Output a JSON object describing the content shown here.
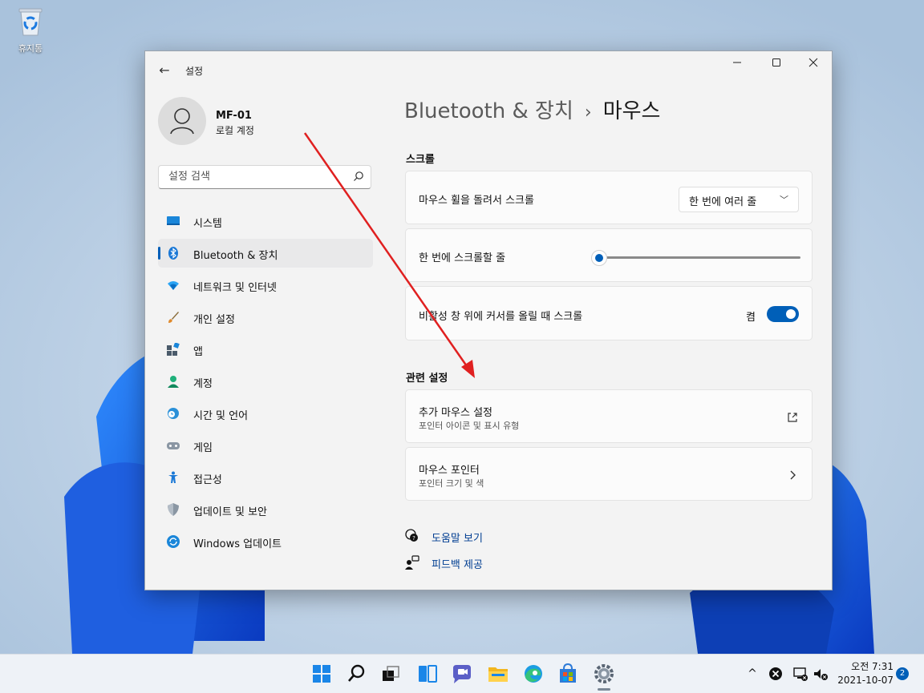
{
  "desktop": {
    "recycle_bin_label": "휴지통"
  },
  "window": {
    "app_title": "설정",
    "controls": {
      "minimize": "—",
      "maximize": "☐",
      "close": "✕"
    }
  },
  "profile": {
    "name": "MF-01",
    "account_type": "로컬 계정"
  },
  "search": {
    "placeholder": "설정 검색"
  },
  "sidebar": {
    "items": [
      {
        "label": "시스템",
        "icon": "system-icon"
      },
      {
        "label": "Bluetooth & 장치",
        "icon": "bluetooth-icon",
        "selected": true
      },
      {
        "label": "네트워크 및 인터넷",
        "icon": "network-icon"
      },
      {
        "label": "개인 설정",
        "icon": "personalization-brush-icon"
      },
      {
        "label": "앱",
        "icon": "apps-icon"
      },
      {
        "label": "계정",
        "icon": "accounts-icon"
      },
      {
        "label": "시간 및 언어",
        "icon": "time-language-icon"
      },
      {
        "label": "게임",
        "icon": "gaming-icon"
      },
      {
        "label": "접근성",
        "icon": "accessibility-icon"
      },
      {
        "label": "업데이트 및 보안",
        "icon": "shield-icon"
      },
      {
        "label": "Windows 업데이트",
        "icon": "windows-update-icon"
      }
    ]
  },
  "breadcrumb": {
    "parent": "Bluetooth & 장치",
    "separator": "›",
    "current": "마우스"
  },
  "scroll_section": {
    "title": "스크롤",
    "wheel_row": {
      "label": "마우스 휠을 돌려서 스크롤",
      "selected_option": "한 번에 여러 줄"
    },
    "lines_row": {
      "label": "한 번에 스크롤할 줄",
      "slider_fraction": 0.02
    },
    "inactive_row": {
      "label": "비활성 창 위에 커서를 올릴 때 스크롤",
      "toggle_state": "켬",
      "toggle_on": true
    }
  },
  "related_section": {
    "title": "관련 설정",
    "items": [
      {
        "label": "추가 마우스 설정",
        "sub": "포인터 아이콘 및 표시 유형",
        "end_icon": "external-link-icon"
      },
      {
        "label": "마우스 포인터",
        "sub": "포인터 크기 및 색",
        "end_icon": "chevron-right-icon"
      }
    ]
  },
  "help": {
    "get_help": "도움말 보기",
    "feedback": "피드백 제공"
  },
  "taskbar": {
    "apps": [
      "start-icon",
      "search-icon",
      "task-view-icon",
      "widgets-icon",
      "chat-icon",
      "file-explorer-icon",
      "edge-icon",
      "store-icon",
      "settings-icon"
    ],
    "tray_chevron": "^",
    "time": "오전 7:31",
    "date": "2021-10-07",
    "notification_count": "2"
  },
  "colors": {
    "accent": "#005fb8",
    "annotation_arrow": "#e02020"
  }
}
